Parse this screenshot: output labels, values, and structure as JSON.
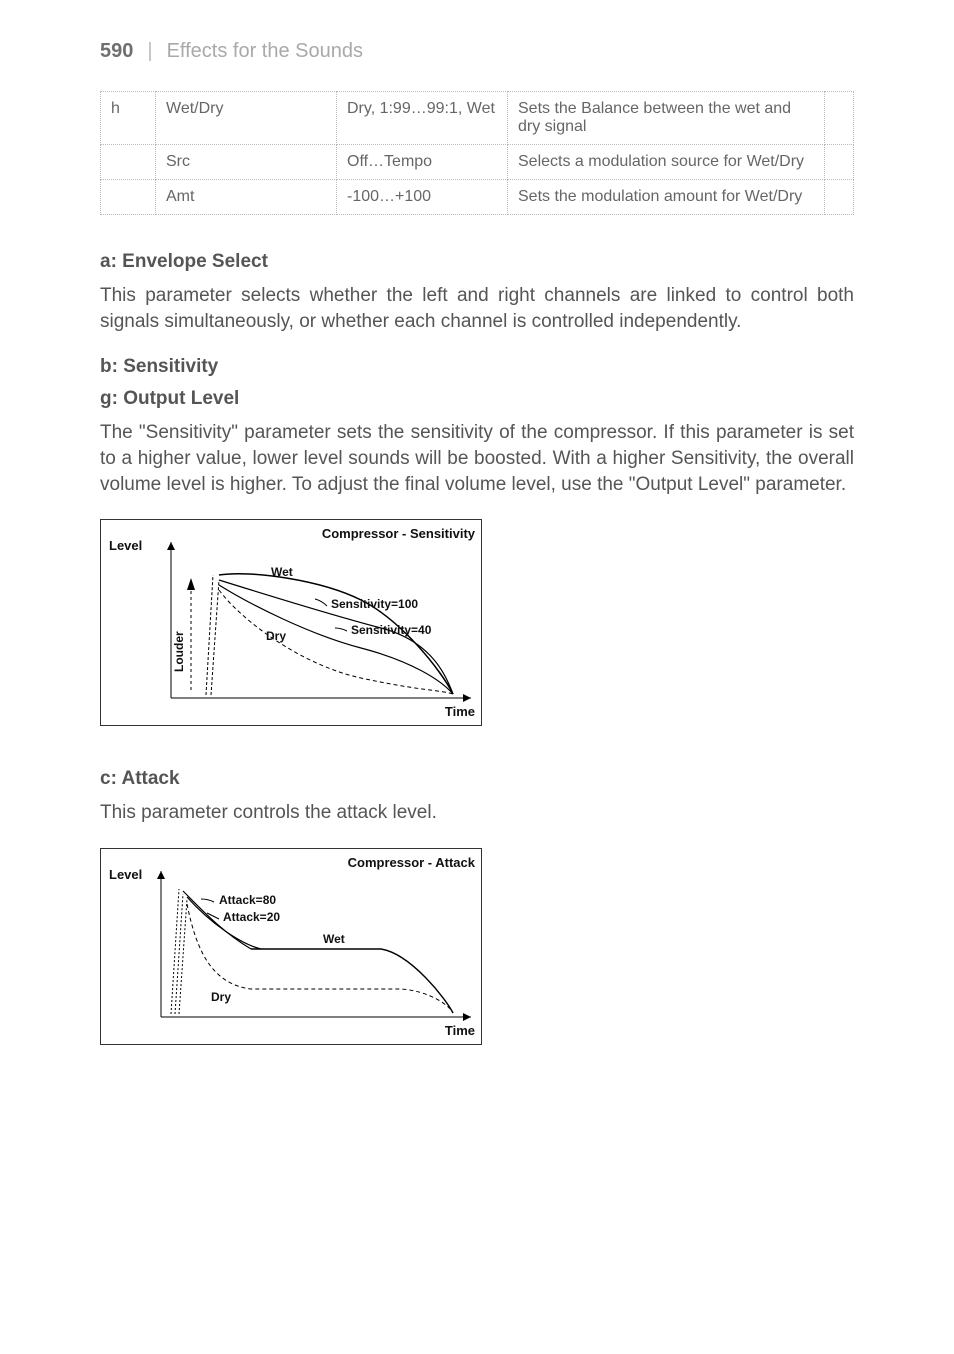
{
  "header": {
    "page_number": "590",
    "separator": "|",
    "section": "Effects for the Sounds"
  },
  "table": {
    "rows": [
      {
        "key": "h",
        "name": "Wet/Dry",
        "range": "Dry, 1:99…99:1, Wet",
        "desc": "Sets the Balance between the wet and dry signal"
      },
      {
        "key": "",
        "name": "Src",
        "range": "Off…Tempo",
        "desc": "Selects a modulation source for Wet/Dry"
      },
      {
        "key": "",
        "name": "Amt",
        "range": "-100…+100",
        "desc": "Sets the modulation amount for Wet/Dry"
      }
    ]
  },
  "subheads": {
    "a": "a: Envelope Select",
    "b": "b: Sensitivity",
    "g": "g: Output Level",
    "c": "c: Attack"
  },
  "paras": {
    "a": "This parameter selects whether the left and right channels are linked to control both signals simultaneously, or whether each channel is controlled independently.",
    "bg": "The \"Sensitivity\" parameter sets the sensitivity of the compressor. If this parameter is set to a higher value, lower level sounds will be boosted. With a higher Sensitivity, the overall volume level is higher. To adjust the final volume level, use the \"Output Level\" parameter.",
    "c": "This parameter controls the attack level."
  },
  "diagram_sensitivity": {
    "title": "Compressor - Sensitivity",
    "y_label": "Level",
    "x_label": "Time",
    "side_label": "Louder",
    "curves": {
      "wet": "Wet",
      "dry": "Dry",
      "s100": "Sensitivity=100",
      "s40": "Sensitivity=40"
    }
  },
  "diagram_attack": {
    "title": "Compressor - Attack",
    "y_label": "Level",
    "x_label": "Time",
    "curves": {
      "a80": "Attack=80",
      "a20": "Attack=20",
      "wet": "Wet",
      "dry": "Dry"
    }
  }
}
